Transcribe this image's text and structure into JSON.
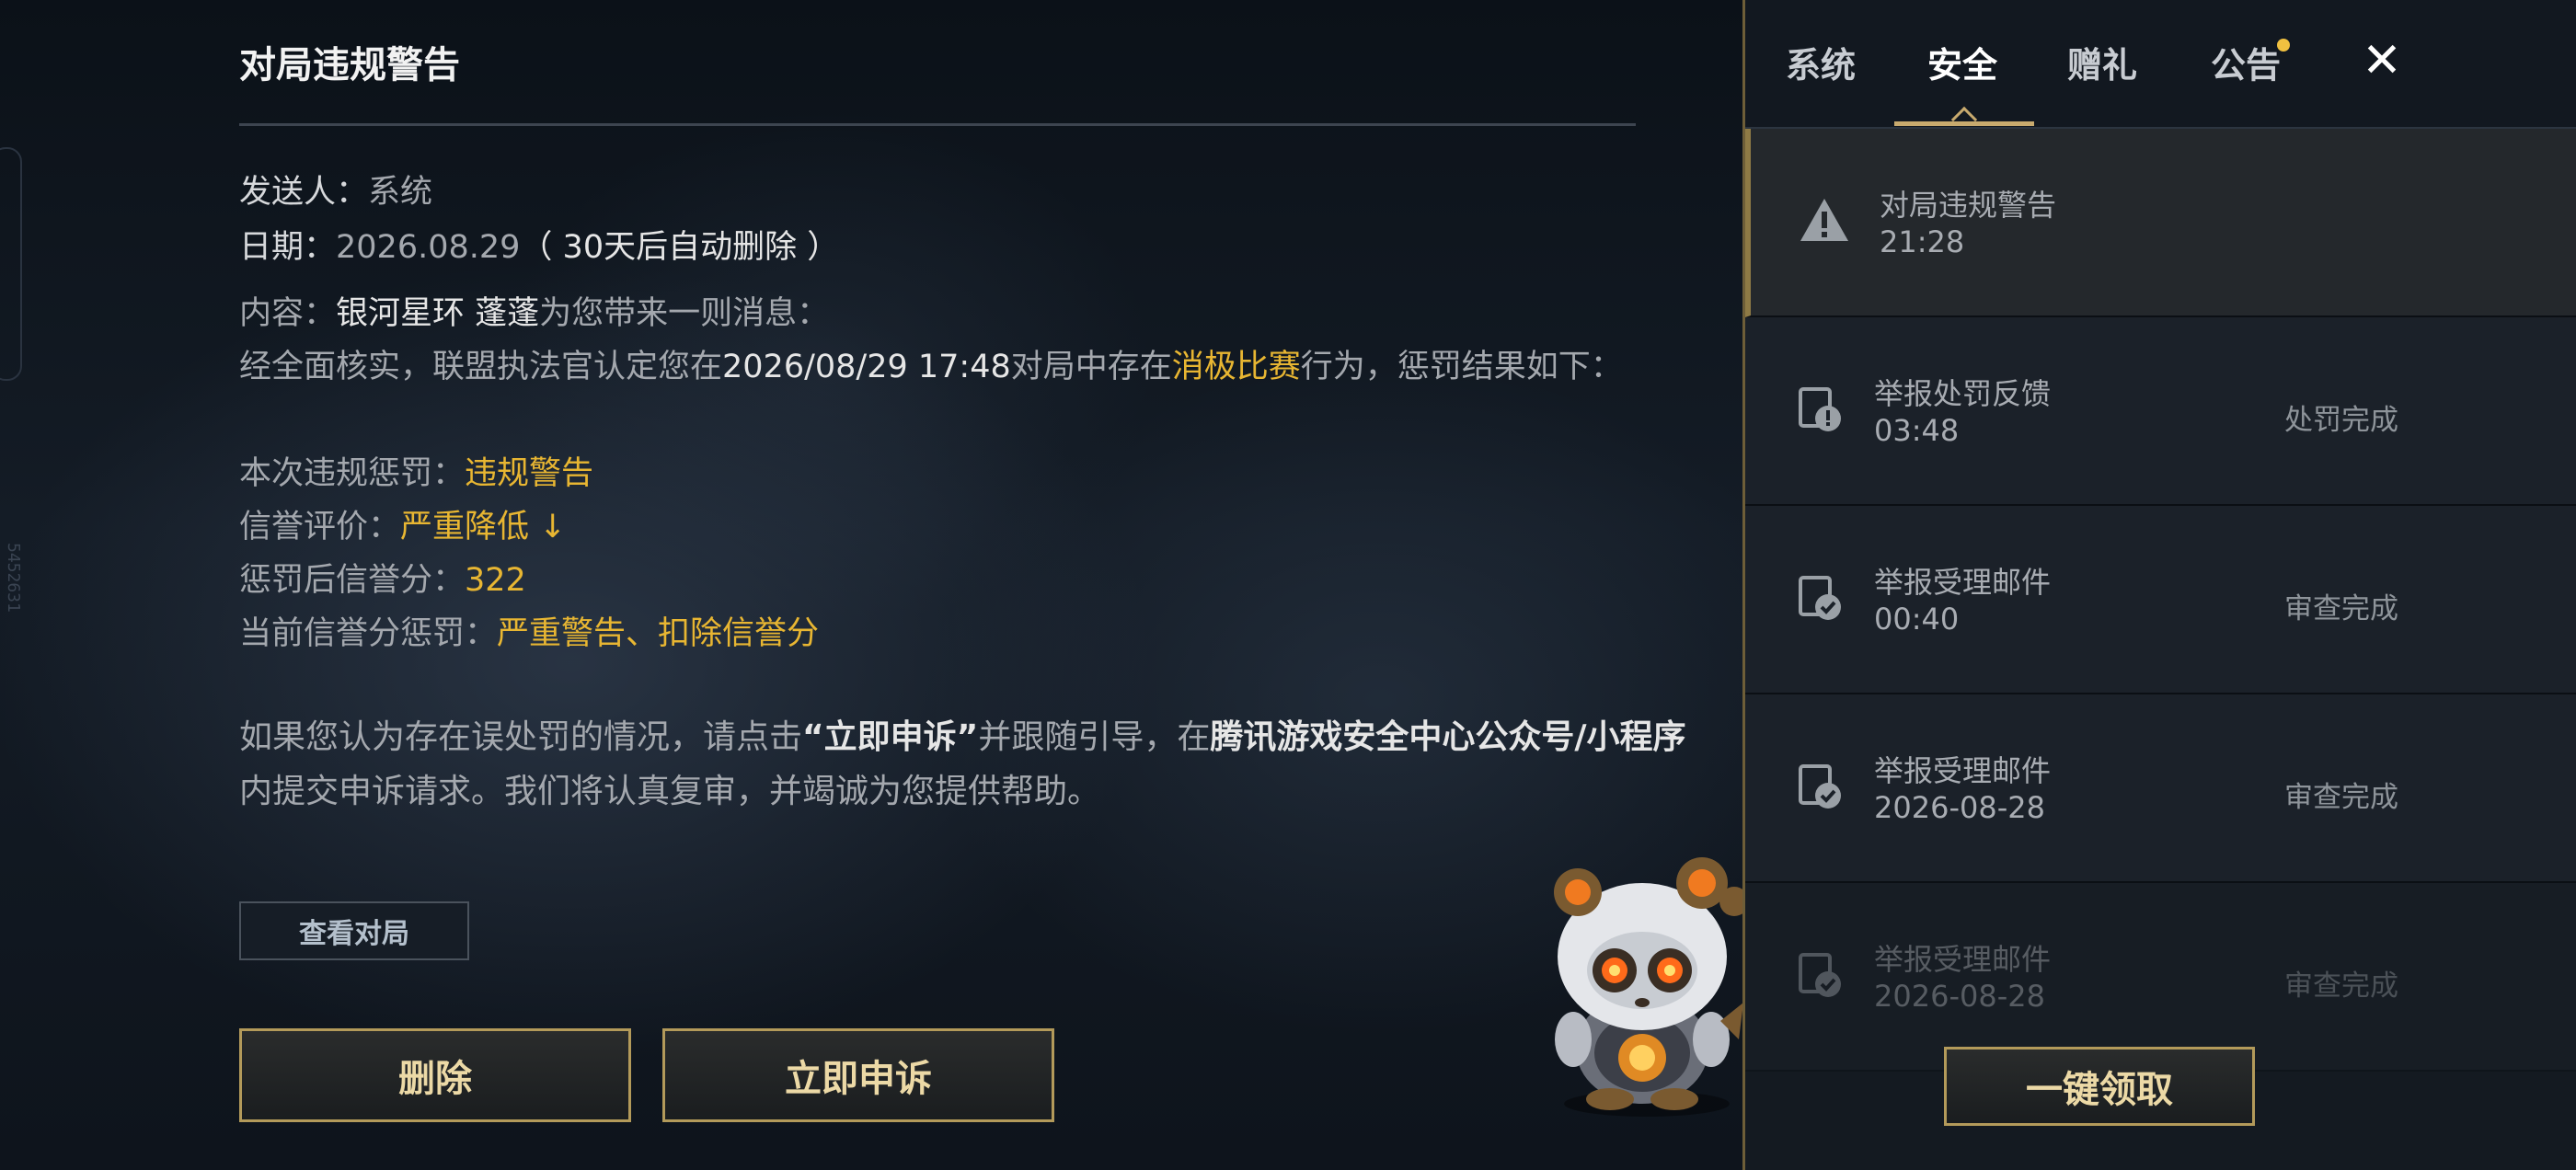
{
  "side_code": "5452631",
  "mail": {
    "title": "对局违规警告",
    "sender_label": "发送人：",
    "sender_value": "系统",
    "date_label": "日期：",
    "date_value": "2026.08.29",
    "date_note": "（ 30天后自动删除 ）",
    "content_label": "内容：",
    "content_from": "银河星环 蓬蓬",
    "content_intro": "为您带来一则消息：",
    "verdict_pre": "经全面核实，联盟执法官认定您在",
    "verdict_time": "2026/08/29 17:48",
    "verdict_mid": "对局中存在",
    "verdict_behavior": "消极比赛",
    "verdict_post": "行为，惩罚结果如下：",
    "penalty_label": "本次违规惩罚：",
    "penalty_value": "违规警告",
    "credit_label": "信誉评价：",
    "credit_value": "严重降低 ↓",
    "score_label": "惩罚后信誉分：",
    "score_value": "322",
    "current_label": "当前信誉分惩罚：",
    "current_value": "严重警告、扣除信誉分",
    "appeal_p1": "如果您认为存在误处罚的情况，请点击",
    "appeal_bold1": "“立即申诉”",
    "appeal_p2": "并跟随引导，在",
    "appeal_bold2": "腾讯游戏安全中心公众号/小程序",
    "appeal_p3": "内提交申诉请求。我们将认真复审，并竭诚为您提供帮助。",
    "view_match_label": "查看对局",
    "delete_label": "删除",
    "appeal_label": "立即申诉"
  },
  "panel": {
    "tabs": [
      {
        "label": "系统"
      },
      {
        "label": "安全"
      },
      {
        "label": "赠礼"
      },
      {
        "label": "公告"
      }
    ],
    "active_tab": "安全",
    "close_icon": "✕",
    "items": [
      {
        "icon": "warning-icon",
        "title": "对局违规警告",
        "time": "21:28",
        "status": ""
      },
      {
        "icon": "report-penalty-icon",
        "title": "举报处罚反馈",
        "time": "03:48",
        "status": "处罚完成"
      },
      {
        "icon": "report-check-icon",
        "title": "举报受理邮件",
        "time": "00:40",
        "status": "审查完成"
      },
      {
        "icon": "report-check-icon",
        "title": "举报受理邮件",
        "time": "2026-08-28",
        "status": "审查完成"
      },
      {
        "icon": "report-check-icon",
        "title": "举报受理邮件",
        "time": "2026-08-28",
        "status": "审查完成"
      }
    ],
    "claim_all_label": "一键领取"
  }
}
